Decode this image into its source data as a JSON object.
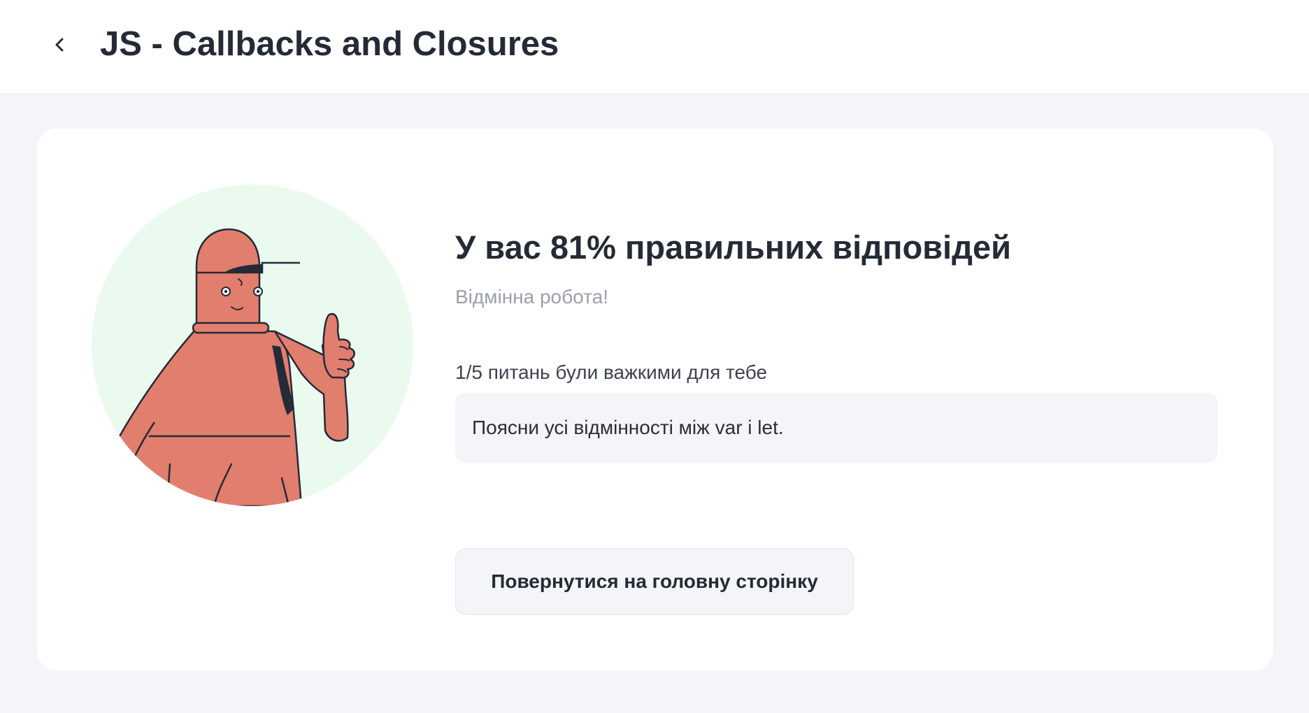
{
  "header": {
    "title": "JS - Callbacks and Closures",
    "back_icon": "chevron-left-icon"
  },
  "result": {
    "title": "У вас 81% правильних відповідей",
    "score_percent": 81,
    "subtitle": "Відмінна робота!",
    "hard_label": "1/5 питань були важкими для тебе",
    "hard_questions": [
      "Поясни усі відмінності між var і let."
    ],
    "home_button_label": "Повернутися на головну сторінку"
  },
  "illustration": {
    "subject": "thumbs-up-character",
    "circle_color": "#eafaee",
    "figure_color": "#e27e6e"
  }
}
